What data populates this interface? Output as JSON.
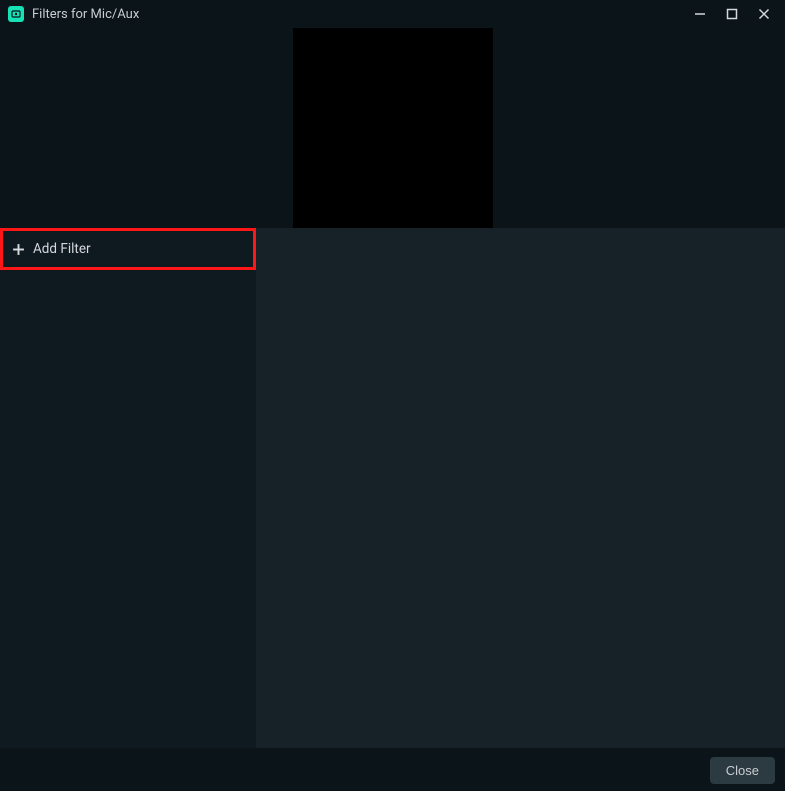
{
  "window": {
    "title": "Filters for Mic/Aux"
  },
  "sidebar": {
    "add_filter_label": "Add Filter"
  },
  "footer": {
    "close_label": "Close"
  }
}
